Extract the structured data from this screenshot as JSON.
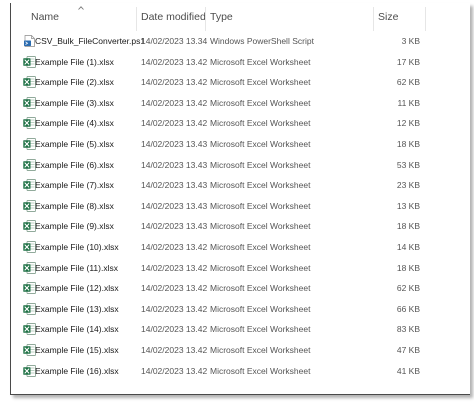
{
  "header": {
    "name": "Name",
    "date": "Date modified",
    "type": "Type",
    "size": "Size"
  },
  "colors": {
    "excel_green": "#1e7145",
    "script_blue": "#2b6cb0"
  },
  "files": [
    {
      "name": "CSV_Bulk_FileConverter.ps1",
      "date": "14/02/2023 13.34",
      "type": "Windows PowerShell Script",
      "size": "3 KB",
      "icon": "powershell-icon"
    },
    {
      "name": "Example File (1).xlsx",
      "date": "14/02/2023 13.42",
      "type": "Microsoft Excel Worksheet",
      "size": "17 KB",
      "icon": "excel-icon"
    },
    {
      "name": "Example File (2).xlsx",
      "date": "14/02/2023 13.42",
      "type": "Microsoft Excel Worksheet",
      "size": "62 KB",
      "icon": "excel-icon"
    },
    {
      "name": "Example File (3).xlsx",
      "date": "14/02/2023 13.42",
      "type": "Microsoft Excel Worksheet",
      "size": "11 KB",
      "icon": "excel-icon"
    },
    {
      "name": "Example File (4).xlsx",
      "date": "14/02/2023 13.42",
      "type": "Microsoft Excel Worksheet",
      "size": "12 KB",
      "icon": "excel-icon"
    },
    {
      "name": "Example File (5).xlsx",
      "date": "14/02/2023 13.43",
      "type": "Microsoft Excel Worksheet",
      "size": "18 KB",
      "icon": "excel-icon"
    },
    {
      "name": "Example File (6).xlsx",
      "date": "14/02/2023 13.43",
      "type": "Microsoft Excel Worksheet",
      "size": "53 KB",
      "icon": "excel-icon"
    },
    {
      "name": "Example File (7).xlsx",
      "date": "14/02/2023 13.43",
      "type": "Microsoft Excel Worksheet",
      "size": "23 KB",
      "icon": "excel-icon"
    },
    {
      "name": "Example File (8).xlsx",
      "date": "14/02/2023 13.43",
      "type": "Microsoft Excel Worksheet",
      "size": "13 KB",
      "icon": "excel-icon"
    },
    {
      "name": "Example File (9).xlsx",
      "date": "14/02/2023 13.43",
      "type": "Microsoft Excel Worksheet",
      "size": "18 KB",
      "icon": "excel-icon"
    },
    {
      "name": "Example File (10).xlsx",
      "date": "14/02/2023 13.42",
      "type": "Microsoft Excel Worksheet",
      "size": "14 KB",
      "icon": "excel-icon"
    },
    {
      "name": "Example File (11).xlsx",
      "date": "14/02/2023 13.42",
      "type": "Microsoft Excel Worksheet",
      "size": "18 KB",
      "icon": "excel-icon"
    },
    {
      "name": "Example File (12).xlsx",
      "date": "14/02/2023 13.42",
      "type": "Microsoft Excel Worksheet",
      "size": "62 KB",
      "icon": "excel-icon"
    },
    {
      "name": "Example File (13).xlsx",
      "date": "14/02/2023 13.42",
      "type": "Microsoft Excel Worksheet",
      "size": "66 KB",
      "icon": "excel-icon"
    },
    {
      "name": "Example File (14).xlsx",
      "date": "14/02/2023 13.42",
      "type": "Microsoft Excel Worksheet",
      "size": "83 KB",
      "icon": "excel-icon"
    },
    {
      "name": "Example File (15).xlsx",
      "date": "14/02/2023 13.42",
      "type": "Microsoft Excel Worksheet",
      "size": "47 KB",
      "icon": "excel-icon"
    },
    {
      "name": "Example File (16).xlsx",
      "date": "14/02/2023 13.42",
      "type": "Microsoft Excel Worksheet",
      "size": "41 KB",
      "icon": "excel-icon"
    }
  ]
}
